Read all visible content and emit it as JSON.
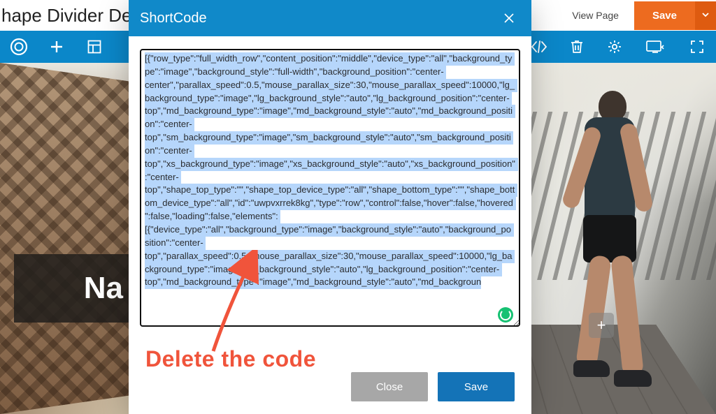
{
  "top": {
    "page_title_partial": "hape Divider De",
    "view_page": "View Page",
    "save": "Save"
  },
  "toolbar": {
    "icons": {
      "logo": "circle-logo-icon",
      "add": "plus-icon",
      "layout": "layout-icon",
      "code": "code-icon",
      "trash": "trash-icon",
      "settings": "gear-icon",
      "devices": "devices-icon",
      "fullscreen": "fullscreen-icon"
    }
  },
  "hero": {
    "overlay_text": "Na",
    "add_button_glyph": "+"
  },
  "modal": {
    "title": "ShortCode",
    "close_label": "Close",
    "save_label": "Save",
    "code": "[{\"row_type\":\"full_width_row\",\"content_position\":\"middle\",\"device_type\":\"all\",\"background_type\":\"image\",\"background_style\":\"full-width\",\"background_position\":\"center-center\",\"parallax_speed\":0.5,\"mouse_parallax_size\":30,\"mouse_parallax_speed\":10000,\"lg_background_type\":\"image\",\"lg_background_style\":\"auto\",\"lg_background_position\":\"center-top\",\"md_background_type\":\"image\",\"md_background_style\":\"auto\",\"md_background_position\":\"center-top\",\"sm_background_type\":\"image\",\"sm_background_style\":\"auto\",\"sm_background_position\":\"center-top\",\"xs_background_type\":\"image\",\"xs_background_style\":\"auto\",\"xs_background_position\":\"center-top\",\"shape_top_type\":\"\",\"shape_top_device_type\":\"all\",\"shape_bottom_type\":\"\",\"shape_bottom_device_type\":\"all\",\"id\":\"uwpvxrrek8kg\",\"type\":\"row\",\"control\":false,\"hover\":false,\"hovered\":false,\"loading\":false,\"elements\":[{\"device_type\":\"all\",\"background_type\":\"image\",\"background_style\":\"auto\",\"background_position\":\"center-top\",\"parallax_speed\":0.5,\"mouse_parallax_size\":30,\"mouse_parallax_speed\":10000,\"lg_background_type\":\"image\",\"lg_background_style\":\"auto\",\"lg_background_position\":\"center-top\",\"md_background_type\":\"image\",\"md_background_style\":\"auto\",\"md_backgroun"
  },
  "annotation": {
    "text": "Delete the code"
  }
}
